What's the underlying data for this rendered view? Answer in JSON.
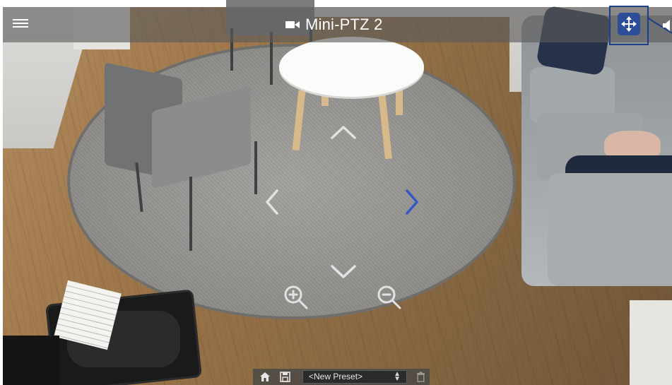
{
  "camera": {
    "title": "Mini-PTZ 2",
    "camera_icon": "video-camera-icon"
  },
  "top_bar": {
    "menu_icon": "hamburger-menu-icon",
    "ptz_control_icon": "move-arrows-icon",
    "speaker_icon": "speaker-icon"
  },
  "ptz_overlay": {
    "up_icon": "chevron-up-icon",
    "down_icon": "chevron-down-icon",
    "left_icon": "chevron-left-icon",
    "right_icon": "chevron-right-icon",
    "zoom_in_icon": "zoom-in-icon",
    "zoom_out_icon": "zoom-out-icon"
  },
  "preset_bar": {
    "home_icon": "home-icon",
    "save_icon": "save-icon",
    "preset_selected": "<New Preset>",
    "delete_icon": "trash-icon"
  },
  "colors": {
    "accent": "#2e4d98",
    "highlight_outline": "#1e3f86",
    "active_arrow": "#3556c9",
    "overlay_icon": "#dcdcdc"
  }
}
